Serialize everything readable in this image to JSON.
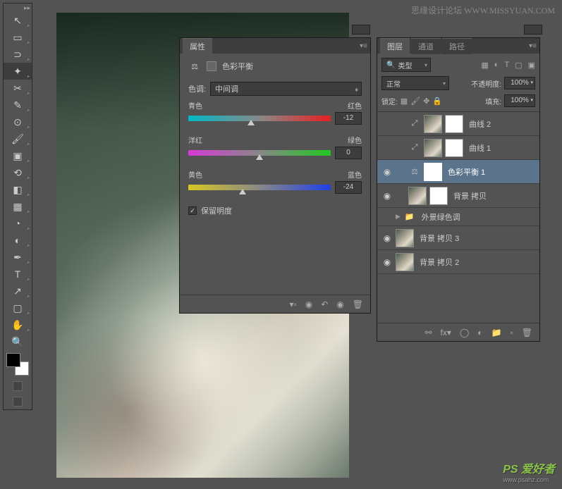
{
  "watermark": {
    "top": "思缘设计论坛 WWW.MISSYUAN.COM",
    "bottom_main": "PS 爱好者",
    "bottom_sub": "www.psahz.com"
  },
  "properties": {
    "panel_title": "属性",
    "adjustment_name": "色彩平衡",
    "tone_label": "色调:",
    "tone_value": "中间调",
    "sliders": [
      {
        "left": "青色",
        "right": "红色",
        "value": "-12",
        "pos": 44
      },
      {
        "left": "洋红",
        "right": "绿色",
        "value": "0",
        "pos": 50
      },
      {
        "left": "黄色",
        "right": "蓝色",
        "value": "-24",
        "pos": 38
      }
    ],
    "preserve_label": "保留明度"
  },
  "layers_panel": {
    "tabs": [
      "图层",
      "通道",
      "路径"
    ],
    "filter": "类型",
    "blend_mode": "正常",
    "opacity_label": "不透明度:",
    "opacity_value": "100%",
    "lock_label": "锁定:",
    "fill_label": "填充:",
    "fill_value": "100%",
    "layers": [
      {
        "visible": false,
        "type": "adj",
        "name": "曲线 2"
      },
      {
        "visible": false,
        "type": "adj",
        "name": "曲线 1"
      },
      {
        "visible": true,
        "type": "adj",
        "name": "色彩平衡 1",
        "selected": true
      },
      {
        "visible": true,
        "type": "image",
        "name": "背景 拷贝"
      },
      {
        "visible": false,
        "type": "group",
        "name": "外景绿色调"
      },
      {
        "visible": true,
        "type": "image",
        "name": "背景 拷贝 3"
      },
      {
        "visible": true,
        "type": "image",
        "name": "背景 拷贝 2"
      }
    ]
  }
}
